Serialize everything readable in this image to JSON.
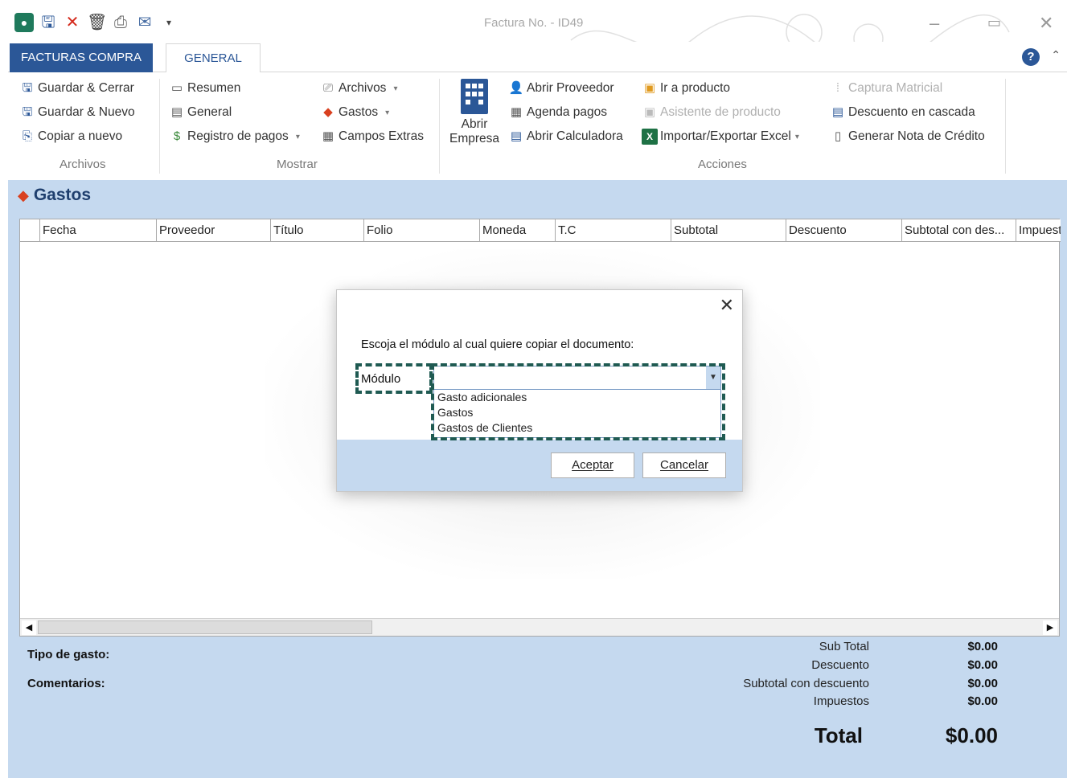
{
  "window": {
    "title": "Factura No. - ID49",
    "colors": {
      "accent": "#2b5797",
      "panel": "#c5d9ef",
      "highlight": "#1f5a52"
    }
  },
  "quick_access": [
    "app-logo-icon",
    "save-icon",
    "delete-icon",
    "trash-icon",
    "print-icon",
    "email-icon",
    "customize-icon"
  ],
  "tabs": {
    "file_tab": "FACTURAS COMPRA",
    "general_tab": "GENERAL"
  },
  "ribbon": {
    "archivos": {
      "guardar_cerrar": "Guardar & Cerrar",
      "guardar_nuevo": "Guardar & Nuevo",
      "copiar_nuevo": "Copiar a nuevo",
      "label": "Archivos"
    },
    "mostrar": {
      "resumen": "Resumen",
      "general": "General",
      "registro_pagos": "Registro de pagos",
      "archivos": "Archivos",
      "gastos": "Gastos",
      "campos_extras": "Campos Extras",
      "label": "Mostrar"
    },
    "acciones": {
      "abrir_empresa_1": "Abrir",
      "abrir_empresa_2": "Empresa",
      "abrir_proveedor": "Abrir Proveedor",
      "agenda_pagos": "Agenda pagos",
      "abrir_calculadora": "Abrir Calculadora",
      "ir_producto": "Ir a producto",
      "asistente_producto": "Asistente de producto",
      "importar_exportar": "Importar/Exportar Excel",
      "captura_matricial": "Captura Matricial",
      "descuento_cascada": "Descuento en cascada",
      "nota_credito": "Generar Nota de Crédito",
      "label": "Acciones"
    }
  },
  "section": {
    "title": "Gastos"
  },
  "grid": {
    "columns": [
      "Fecha",
      "Proveedor",
      "Título",
      "Folio",
      "Moneda",
      "T.C",
      "Subtotal",
      "Descuento",
      "Subtotal con des...",
      "Impuest"
    ],
    "rows": []
  },
  "footer": {
    "tipo_gasto": "Tipo de gasto:",
    "comentarios": "Comentarios:",
    "subtotal_label": "Sub Total",
    "subtotal_value": "$0.00",
    "descuento_label": "Descuento",
    "descuento_value": "$0.00",
    "subtotal_desc_label": "Subtotal con descuento",
    "subtotal_desc_value": "$0.00",
    "impuestos_label": "Impuestos",
    "impuestos_value": "$0.00",
    "total_label": "Total",
    "total_value": "$0.00"
  },
  "dialog": {
    "close": "✕",
    "prompt": "Escoja el módulo al cual quiere copiar el documento:",
    "field_label": "Módulo",
    "selected_value": "",
    "options": [
      "Gasto adicionales",
      "Gastos",
      "Gastos de Clientes"
    ],
    "accept": "Aceptar",
    "cancel": "Cancelar"
  }
}
